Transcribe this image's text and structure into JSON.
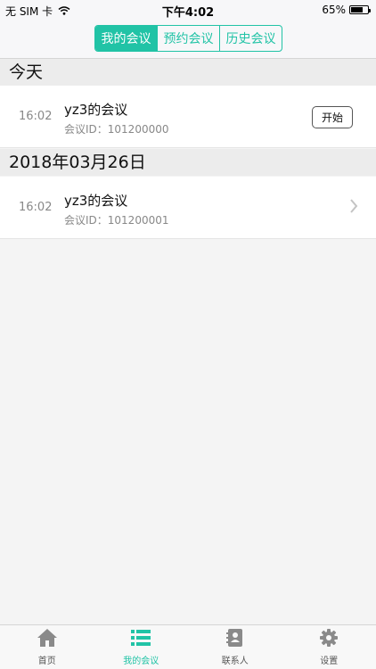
{
  "status_bar": {
    "carrier": "无 SIM 卡",
    "time": "下午4:02",
    "battery": "65%",
    "battery_level": 0.65
  },
  "header": {
    "tabs": [
      {
        "label": "我的会议",
        "active": true
      },
      {
        "label": "预约会议",
        "active": false
      },
      {
        "label": "历史会议",
        "active": false
      }
    ]
  },
  "sections": [
    {
      "title": "今天",
      "rows": [
        {
          "time": "16:02",
          "title": "yz3的会议",
          "meeting_id": "会议ID：101200000",
          "action_label": "开始"
        }
      ]
    },
    {
      "title": "2018年03月26日",
      "rows": [
        {
          "time": "16:02",
          "title": "yz3的会议",
          "meeting_id": "会议ID：101200001"
        }
      ]
    }
  ],
  "tab_bar": {
    "items": [
      {
        "label": "首页",
        "icon": "home-icon",
        "active": false
      },
      {
        "label": "我的会议",
        "icon": "list-icon",
        "active": true
      },
      {
        "label": "联系人",
        "icon": "contacts-icon",
        "active": false
      },
      {
        "label": "设置",
        "icon": "gear-icon",
        "active": false
      }
    ]
  },
  "colors": {
    "accent": "#21c3a6",
    "background": "#f4f4f4",
    "section_header": "#ececec"
  }
}
